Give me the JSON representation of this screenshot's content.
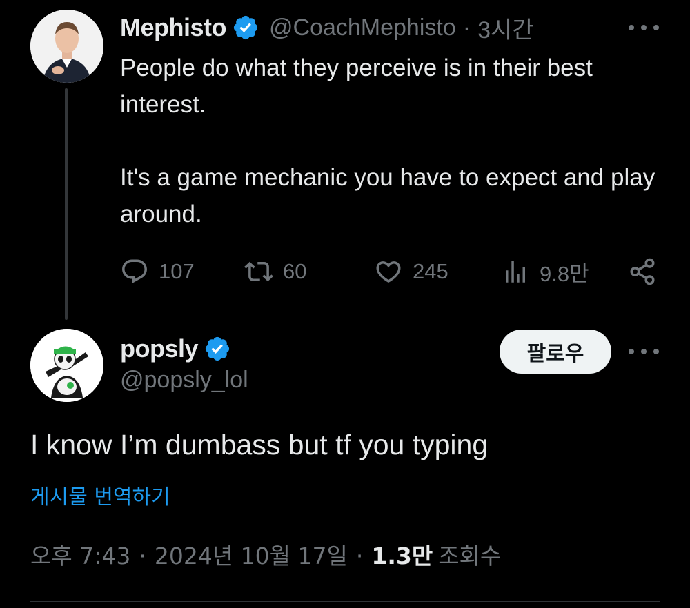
{
  "parent_tweet": {
    "display_name": "Mephisto",
    "handle": "@CoachMephisto",
    "separator": "·",
    "time": "3시간",
    "paragraphs": [
      "People do what they perceive is in their best interest.",
      "It's a game mechanic you have to expect and play around."
    ],
    "actions": {
      "replies": "107",
      "retweets": "60",
      "likes": "245",
      "views": "9.8만"
    }
  },
  "reply_tweet": {
    "display_name": "popsly",
    "handle": "@popsly_lol",
    "follow_label": "팔로우",
    "text": "I know I’m dumbass but tf you typing",
    "translate_label": "게시물 번역하기",
    "time": "오후 7:43",
    "separator": "·",
    "date": "2024년 10월 17일",
    "views_count": "1.3만",
    "views_label": "조회수"
  },
  "colors": {
    "background": "#000000",
    "text_primary": "#e7e9ea",
    "text_secondary": "#71767b",
    "accent_blue": "#1d9bf0",
    "verified_badge": "#1d9bf0",
    "follow_button_bg": "#eff3f4"
  },
  "icons": [
    "reply-icon",
    "retweet-icon",
    "like-icon",
    "views-icon",
    "share-icon",
    "verified-badge-icon",
    "more-icon"
  ]
}
